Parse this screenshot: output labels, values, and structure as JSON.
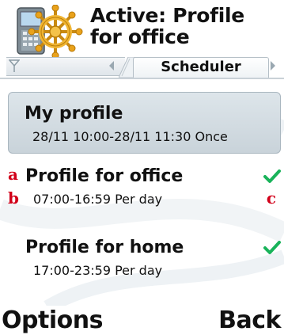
{
  "header": {
    "title_line1": "Active: Profile",
    "title_line2": "for office",
    "icon": "phone-with-ship-wheel-icon"
  },
  "tabs": {
    "active_label": "Scheduler"
  },
  "list": {
    "items": [
      {
        "title": "My profile",
        "schedule": "28/11 10:00-28/11 11:30 Once",
        "selected": true,
        "checked": false
      },
      {
        "title": "Profile for office",
        "schedule": "07:00-16:59 Per day",
        "selected": false,
        "checked": true
      },
      {
        "title": "Profile for home",
        "schedule": "17:00-23:59 Per day",
        "selected": false,
        "checked": true
      }
    ]
  },
  "annotations": {
    "a": "a",
    "b": "b",
    "c": "c"
  },
  "softkeys": {
    "left": "Options",
    "right": "Back"
  },
  "colors": {
    "accent_check": "#19b35a",
    "annotation": "#d2001a",
    "selection": "#cfd8de"
  }
}
